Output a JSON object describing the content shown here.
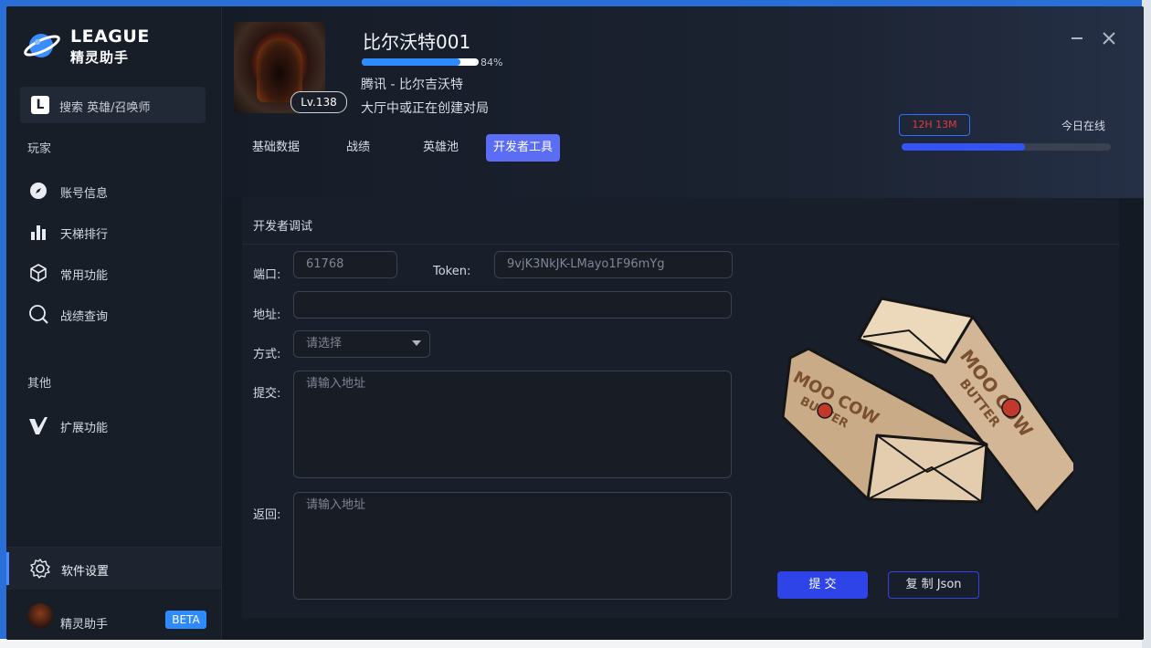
{
  "brand": {
    "name": "LEAGUE",
    "subtitle": "精灵助手"
  },
  "sidebar": {
    "search_label": "搜索 英雄/召唤师",
    "section_player": "玩家",
    "items": [
      {
        "label": "账号信息",
        "icon": "compass-icon"
      },
      {
        "label": "天梯排行",
        "icon": "bar-chart-icon"
      },
      {
        "label": "常用功能",
        "icon": "cube-icon"
      },
      {
        "label": "战绩查询",
        "icon": "magnifier-icon"
      }
    ],
    "section_other": "其他",
    "extra": {
      "label": "扩展功能",
      "icon": "v-logo-icon"
    },
    "settings_label": "软件设置",
    "footer": {
      "name": "精灵助手",
      "badge": "BETA"
    }
  },
  "profile": {
    "name": "比尔沃特001",
    "level": "Lv.138",
    "progress_percent": 84,
    "progress_text": "84%",
    "server": "腾讯 - 比尔吉沃特",
    "status": "大厅中或正在创建对局",
    "online_time": "12H 13M",
    "online_label": "今日在线",
    "online_fraction": 0.59
  },
  "tabs": [
    {
      "label": "基础数据",
      "active": false
    },
    {
      "label": "战绩",
      "active": false
    },
    {
      "label": "英雄池",
      "active": false
    },
    {
      "label": "开发者工具",
      "active": true
    }
  ],
  "devtools": {
    "title": "开发者调试",
    "port_label": "端口:",
    "port_value": "61768",
    "token_label": "Token:",
    "token_value": "9vjK3NkJK-LMayo1F96mYg",
    "address_label": "地址:",
    "address_value": "",
    "method_label": "方式:",
    "method_placeholder": "请选择",
    "submit_label": "提交:",
    "submit_placeholder": "请输入地址",
    "return_label": "返回:",
    "return_placeholder": "请输入地址",
    "submit_button": "提 交",
    "copy_button": "复 制 Json"
  },
  "illustration": {
    "brand_text": "MOO COW",
    "sub_text": "BUTTER"
  },
  "colors": {
    "accent": "#2e43e8",
    "tab_active": "#5b6cf5",
    "progress": "#2e8bff",
    "timer_text": "#e23b3b"
  }
}
